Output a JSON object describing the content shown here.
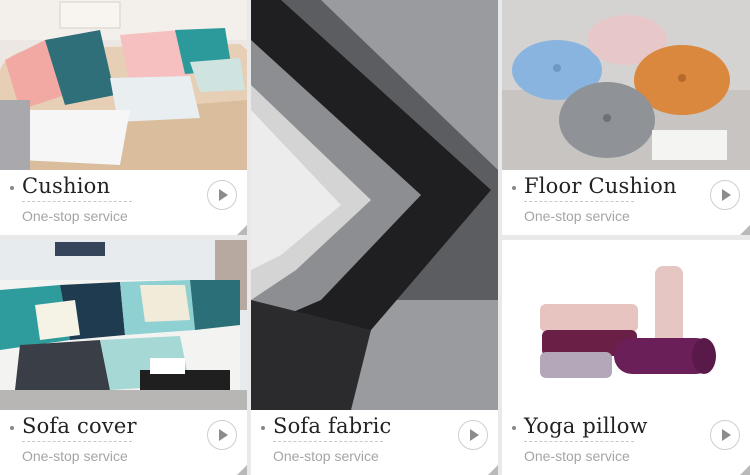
{
  "tiles": [
    {
      "title": "Cushion",
      "subtitle": "One-stop service",
      "image": "cushions-on-sofa-photo"
    },
    {
      "title": "Floor Cushion",
      "subtitle": "One-stop service",
      "image": "round-pleated-floor-cushions-photo"
    },
    {
      "title": "Sofa cover",
      "subtitle": "One-stop service",
      "image": "patterned-sofa-cover-photo"
    },
    {
      "title": "Sofa fabric",
      "subtitle": "One-stop service",
      "image": "layered-linen-fabric-swatches-photo"
    },
    {
      "title": "Yoga pillow",
      "subtitle": "One-stop service",
      "image": "yoga-bolster-pillows-photo"
    }
  ],
  "colors": {
    "background": "#e9e9e9",
    "title_text": "#222222",
    "subtitle_text": "#a5a5a5",
    "accent_gray": "#8c8c8c"
  }
}
